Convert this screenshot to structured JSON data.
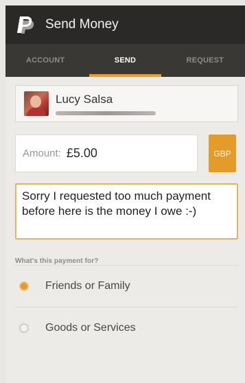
{
  "header": {
    "title": "Send Money",
    "logo_icon": "paypal-logo"
  },
  "tabs": [
    {
      "label": "ACCOUNT",
      "active": false
    },
    {
      "label": "SEND",
      "active": true
    },
    {
      "label": "REQUEST",
      "active": false
    }
  ],
  "recipient": {
    "name": "Lucy Salsa"
  },
  "amount": {
    "label": "Amount:",
    "value": "£5.00",
    "currency": "GBP"
  },
  "note": {
    "text": "Sorry I requested too much payment before here is the money I owe :-)"
  },
  "payment_purpose": {
    "label": "What's this payment for?",
    "options": [
      {
        "label": "Friends or Family",
        "selected": true
      },
      {
        "label": "Goods or Services",
        "selected": false
      }
    ]
  },
  "colors": {
    "accent": "#e39b2a",
    "appbar": "#2b2927",
    "tabbar": "#3a3835"
  }
}
